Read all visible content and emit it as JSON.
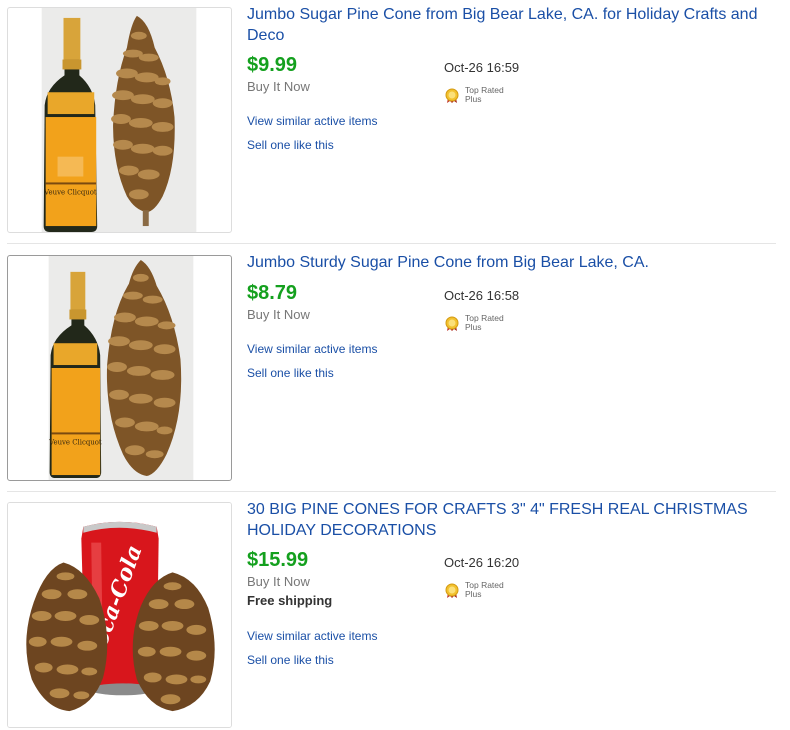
{
  "items": [
    {
      "title": "Jumbo Sugar Pine Cone from Big Bear Lake, CA. for Holiday Crafts and Deco",
      "price": "$9.99",
      "format": "Buy It Now",
      "date": "Oct-26 16:59",
      "badge": "Top Rated Plus",
      "badge_line1": "Top Rated",
      "badge_line2": "Plus",
      "link_similar": "View similar active items",
      "link_sell": "Sell one like this",
      "image": "champagne-bottle-and-pine-cone"
    },
    {
      "title": "Jumbo Sturdy Sugar Pine Cone from Big Bear Lake, CA.",
      "price": "$8.79",
      "format": "Buy It Now",
      "date": "Oct-26 16:58",
      "badge": "Top Rated Plus",
      "badge_line1": "Top Rated",
      "badge_line2": "Plus",
      "link_similar": "View similar active items",
      "link_sell": "Sell one like this",
      "image": "champagne-bottle-and-pine-cone"
    },
    {
      "title": "30 BIG PINE CONES FOR CRAFTS 3\" 4\" FRESH REAL CHRISTMAS HOLIDAY DECORATIONS",
      "price": "$15.99",
      "format": "Buy It Now",
      "shipping": "Free shipping",
      "date": "Oct-26 16:20",
      "badge": "Top Rated Plus",
      "badge_line1": "Top Rated",
      "badge_line2": "Plus",
      "link_similar": "View similar active items",
      "link_sell": "Sell one like this",
      "image": "soda-can-and-pine-cones",
      "image_text": "Coca-Cola"
    }
  ],
  "colors": {
    "link": "#1a4fa6",
    "price": "#14a01e",
    "muted": "#777777",
    "badge_gold": "#f2c12e"
  }
}
